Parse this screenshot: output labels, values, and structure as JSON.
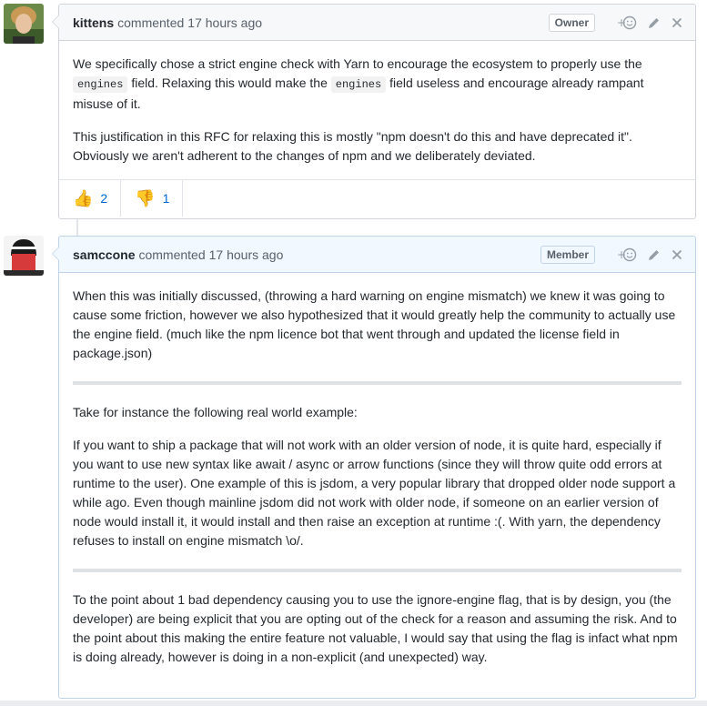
{
  "comments": [
    {
      "author": "kittens",
      "action": "commented",
      "time": "17 hours ago",
      "badge": "Owner",
      "paragraphs": {
        "p1_a": "We specifically chose a strict engine check with Yarn to encourage the ecosystem to properly use the",
        "p1_code1": "engines",
        "p1_b": "field. Relaxing this would make the",
        "p1_code2": "engines",
        "p1_c": "field useless and encourage already rampant misuse of it.",
        "p2": "This justification in this RFC for relaxing this is mostly \"npm doesn't do this and have deprecated it\". Obviously we aren't adherent to the changes of npm and we deliberately deviated."
      },
      "reactions": [
        {
          "emoji": "👍",
          "count": "2"
        },
        {
          "emoji": "👎",
          "count": "1"
        }
      ]
    },
    {
      "author": "samccone",
      "action": "commented",
      "time": "17 hours ago",
      "badge": "Member",
      "paragraphs": {
        "p1": "When this was initially discussed, (throwing a hard warning on engine mismatch) we knew it was going to cause some friction, however we also hypothesized that it would greatly help the community to actually use the engine field. (much like the npm licence bot that went through and updated the license field in package.json)",
        "p2": "Take for instance the following real world example:",
        "p3": "If you want to ship a package that will not work with an older version of node, it is quite hard, especially if you want to use new syntax like await / async or arrow functions (since they will throw quite odd errors at runtime to the user). One example of this is jsdom, a very popular library that dropped older node support a while ago. Even though mainline jsdom did not work with older node, if someone on an earlier version of node would install it, it would install and then raise an exception at runtime :(. With yarn, the dependency refuses to install on engine mismatch \\o/.",
        "p4": "To the point about 1 bad dependency causing you to use the ignore-engine flag, that is by design, you (the developer) are being explicit that you are opting out of the check for a reason and assuming the risk. And to the point about this making the entire feature not valuable, I would say that using the flag is infact what npm is doing already, however is doing in a non-explicit (and unexpected) way."
      }
    }
  ],
  "icons": [
    "add-reaction-icon",
    "edit-pencil-icon",
    "close-icon"
  ],
  "colors": {
    "link": "#0366d6",
    "header_bg": "#f6f8fa",
    "member_header_bg": "#f1f8ff",
    "border": "#d1d5da"
  }
}
